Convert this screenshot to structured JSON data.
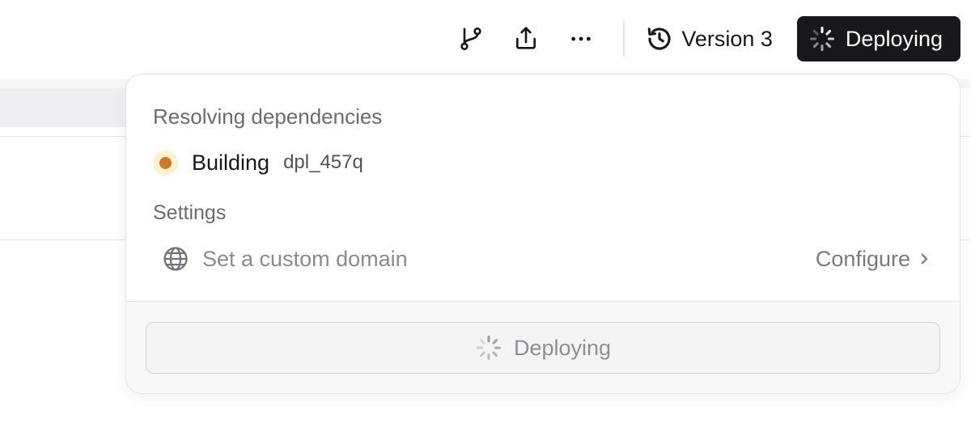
{
  "toolbar": {
    "icons": [
      "git-branch-icon",
      "share-icon",
      "more-icon"
    ],
    "version_label": "Version 3",
    "deploy_label": "Deploying"
  },
  "popover": {
    "status_text": "Resolving dependencies",
    "build": {
      "label": "Building",
      "id": "dpl_457q",
      "dot_color": "#c97a2c"
    },
    "settings_heading": "Settings",
    "domain_row": {
      "text": "Set a custom domain",
      "link_label": "Configure"
    },
    "footer_button_label": "Deploying"
  },
  "colors": {
    "primary_button_bg": "#18181b",
    "muted_text": "#6b6b73",
    "building_dot": "#c97a2c",
    "building_dot_bg": "#fdf1cf"
  }
}
